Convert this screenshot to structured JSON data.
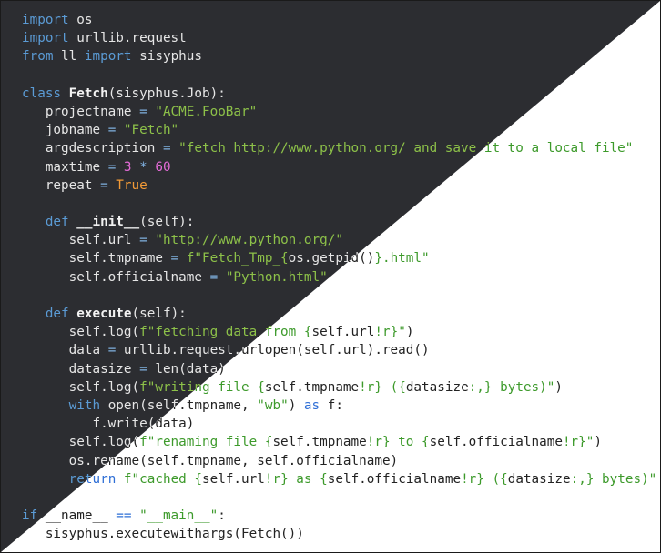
{
  "theme": {
    "dark_bg": "#2c2d31",
    "light_bg": "#ffffff",
    "keyword": "#5b9bd5",
    "string": "#8dc149",
    "number": "#e36bd6",
    "constant": "#f29a37"
  },
  "code": {
    "language": "python",
    "lines": [
      [
        {
          "t": "k",
          "v": "import"
        },
        {
          "t": "p",
          "v": " os"
        }
      ],
      [
        {
          "t": "k",
          "v": "import"
        },
        {
          "t": "p",
          "v": " urllib.request"
        }
      ],
      [
        {
          "t": "k",
          "v": "from"
        },
        {
          "t": "p",
          "v": " ll "
        },
        {
          "t": "k",
          "v": "import"
        },
        {
          "t": "p",
          "v": " sisyphus"
        }
      ],
      [],
      [
        {
          "t": "k",
          "v": "class"
        },
        {
          "t": "p",
          "v": " "
        },
        {
          "t": "b",
          "v": "Fetch"
        },
        {
          "t": "p",
          "v": "(sisyphus.Job):"
        }
      ],
      [
        {
          "t": "p",
          "v": "   projectname "
        },
        {
          "t": "o",
          "v": "="
        },
        {
          "t": "p",
          "v": " "
        },
        {
          "t": "s",
          "v": "\"ACME.FooBar\""
        }
      ],
      [
        {
          "t": "p",
          "v": "   jobname "
        },
        {
          "t": "o",
          "v": "="
        },
        {
          "t": "p",
          "v": " "
        },
        {
          "t": "s",
          "v": "\"Fetch\""
        }
      ],
      [
        {
          "t": "p",
          "v": "   argdescription "
        },
        {
          "t": "o",
          "v": "="
        },
        {
          "t": "p",
          "v": " "
        },
        {
          "t": "s",
          "v": "\"fetch http://www.python.org/ and save it to a local file\""
        }
      ],
      [
        {
          "t": "p",
          "v": "   maxtime "
        },
        {
          "t": "o",
          "v": "="
        },
        {
          "t": "p",
          "v": " "
        },
        {
          "t": "n",
          "v": "3"
        },
        {
          "t": "p",
          "v": " "
        },
        {
          "t": "o",
          "v": "*"
        },
        {
          "t": "p",
          "v": " "
        },
        {
          "t": "n",
          "v": "60"
        }
      ],
      [
        {
          "t": "p",
          "v": "   repeat "
        },
        {
          "t": "o",
          "v": "="
        },
        {
          "t": "p",
          "v": " "
        },
        {
          "t": "c",
          "v": "True"
        }
      ],
      [],
      [
        {
          "t": "p",
          "v": "   "
        },
        {
          "t": "k",
          "v": "def"
        },
        {
          "t": "p",
          "v": " "
        },
        {
          "t": "b",
          "v": "__init__"
        },
        {
          "t": "p",
          "v": "(self):"
        }
      ],
      [
        {
          "t": "p",
          "v": "      self.url "
        },
        {
          "t": "o",
          "v": "="
        },
        {
          "t": "p",
          "v": " "
        },
        {
          "t": "s",
          "v": "\"http://www.python.org/\""
        }
      ],
      [
        {
          "t": "p",
          "v": "      self.tmpname "
        },
        {
          "t": "o",
          "v": "="
        },
        {
          "t": "p",
          "v": " "
        },
        {
          "t": "s",
          "v": "f\"Fetch_Tmp_{"
        },
        {
          "t": "p",
          "v": "os.getpid()"
        },
        {
          "t": "s",
          "v": "}.html\""
        }
      ],
      [
        {
          "t": "p",
          "v": "      self.officialname "
        },
        {
          "t": "o",
          "v": "="
        },
        {
          "t": "p",
          "v": " "
        },
        {
          "t": "s",
          "v": "\"Python.html\""
        }
      ],
      [],
      [
        {
          "t": "p",
          "v": "   "
        },
        {
          "t": "k",
          "v": "def"
        },
        {
          "t": "p",
          "v": " "
        },
        {
          "t": "b",
          "v": "execute"
        },
        {
          "t": "p",
          "v": "(self):"
        }
      ],
      [
        {
          "t": "p",
          "v": "      self.log("
        },
        {
          "t": "s",
          "v": "f\"fetching data from {"
        },
        {
          "t": "p",
          "v": "self.url"
        },
        {
          "t": "s",
          "v": "!r}\""
        },
        {
          "t": "p",
          "v": ")"
        }
      ],
      [
        {
          "t": "p",
          "v": "      data "
        },
        {
          "t": "o",
          "v": "="
        },
        {
          "t": "p",
          "v": " urllib.request.urlopen(self.url).read()"
        }
      ],
      [
        {
          "t": "p",
          "v": "      datasize "
        },
        {
          "t": "o",
          "v": "="
        },
        {
          "t": "p",
          "v": " len(data)"
        }
      ],
      [
        {
          "t": "p",
          "v": "      self.log("
        },
        {
          "t": "s",
          "v": "f\"writing file {"
        },
        {
          "t": "p",
          "v": "self.tmpname"
        },
        {
          "t": "s",
          "v": "!r} ({"
        },
        {
          "t": "p",
          "v": "datasize"
        },
        {
          "t": "s",
          "v": ":,} bytes)\""
        },
        {
          "t": "p",
          "v": ")"
        }
      ],
      [
        {
          "t": "p",
          "v": "      "
        },
        {
          "t": "k",
          "v": "with"
        },
        {
          "t": "p",
          "v": " open(self.tmpname, "
        },
        {
          "t": "s",
          "v": "\"wb\""
        },
        {
          "t": "p",
          "v": ") "
        },
        {
          "t": "k",
          "v": "as"
        },
        {
          "t": "p",
          "v": " f:"
        }
      ],
      [
        {
          "t": "p",
          "v": "         f.write(data)"
        }
      ],
      [
        {
          "t": "p",
          "v": "      self.log("
        },
        {
          "t": "s",
          "v": "f\"renaming file {"
        },
        {
          "t": "p",
          "v": "self.tmpname"
        },
        {
          "t": "s",
          "v": "!r} to {"
        },
        {
          "t": "p",
          "v": "self.officialname"
        },
        {
          "t": "s",
          "v": "!r}\""
        },
        {
          "t": "p",
          "v": ")"
        }
      ],
      [
        {
          "t": "p",
          "v": "      os.rename(self.tmpname, self.officialname)"
        }
      ],
      [
        {
          "t": "p",
          "v": "      "
        },
        {
          "t": "k",
          "v": "return"
        },
        {
          "t": "p",
          "v": " "
        },
        {
          "t": "s",
          "v": "f\"cached {"
        },
        {
          "t": "p",
          "v": "self.url"
        },
        {
          "t": "s",
          "v": "!r} as {"
        },
        {
          "t": "p",
          "v": "self.officialname"
        },
        {
          "t": "s",
          "v": "!r} ({"
        },
        {
          "t": "p",
          "v": "datasize"
        },
        {
          "t": "s",
          "v": ":,} bytes)\""
        }
      ],
      [],
      [
        {
          "t": "k",
          "v": "if"
        },
        {
          "t": "p",
          "v": " __name__ "
        },
        {
          "t": "o",
          "v": "=="
        },
        {
          "t": "p",
          "v": " "
        },
        {
          "t": "s",
          "v": "\"__main__\""
        },
        {
          "t": "p",
          "v": ":"
        }
      ],
      [
        {
          "t": "p",
          "v": "   sisyphus.executewithargs(Fetch())"
        }
      ]
    ]
  }
}
